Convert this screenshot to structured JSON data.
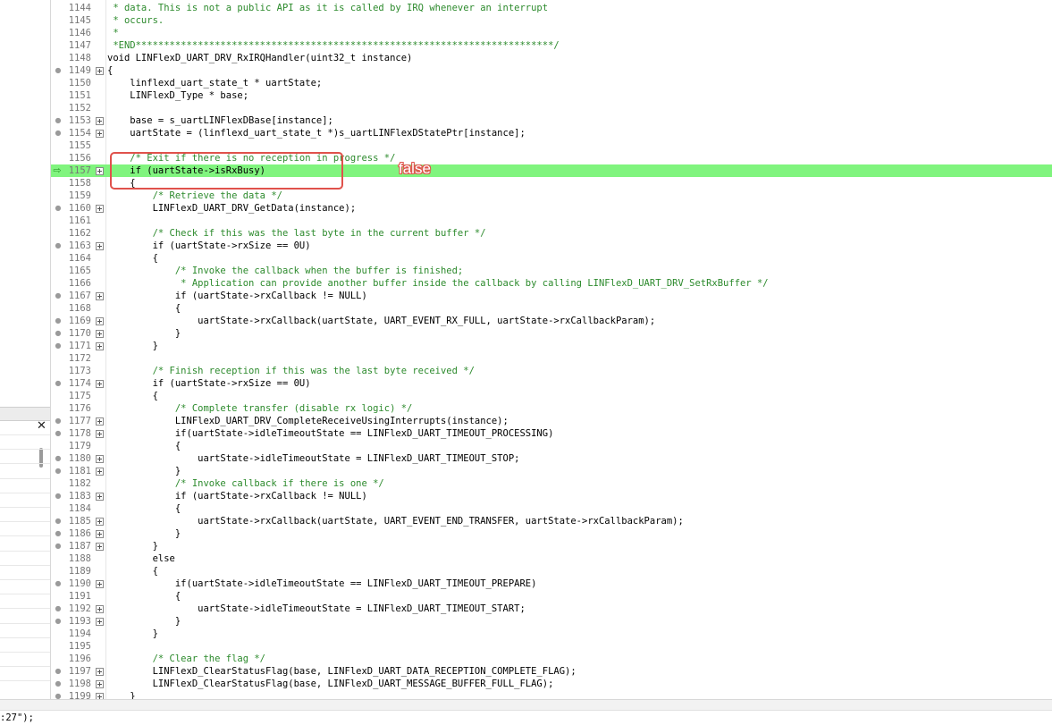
{
  "editor": {
    "lines": [
      {
        "num": "1144",
        "text": " * data. This is not a public API as it is called by IRQ whenever an interrupt",
        "kind": "comment"
      },
      {
        "num": "1145",
        "text": " * occurs.",
        "kind": "comment"
      },
      {
        "num": "1146",
        "text": " *",
        "kind": "comment"
      },
      {
        "num": "1147",
        "text": " *END**************************************************************************/",
        "kind": "comment"
      },
      {
        "num": "1148",
        "text": "void LINFlexD_UART_DRV_RxIRQHandler(uint32_t instance)",
        "kind": "code"
      },
      {
        "num": "1149",
        "text": "{",
        "kind": "code",
        "bp": true,
        "fold": true
      },
      {
        "num": "1150",
        "text": "    linflexd_uart_state_t * uartState;",
        "kind": "code"
      },
      {
        "num": "1151",
        "text": "    LINFlexD_Type * base;",
        "kind": "code"
      },
      {
        "num": "1152",
        "text": "",
        "kind": "code"
      },
      {
        "num": "1153",
        "text": "    base = s_uartLINFlexDBase[instance];",
        "kind": "code",
        "bp": true,
        "fold": true
      },
      {
        "num": "1154",
        "text": "    uartState = (linflexd_uart_state_t *)s_uartLINFlexDStatePtr[instance];",
        "kind": "code",
        "bp": true,
        "fold": true
      },
      {
        "num": "1155",
        "text": "",
        "kind": "code"
      },
      {
        "num": "1156",
        "text": "    /* Exit if there is no reception in progress */",
        "kind": "comment"
      },
      {
        "num": "1157",
        "text": "    if (uartState->isRxBusy)",
        "kind": "code",
        "exec": true,
        "fold": true
      },
      {
        "num": "1158",
        "text": "    {",
        "kind": "code"
      },
      {
        "num": "1159",
        "text": "        /* Retrieve the data */",
        "kind": "comment"
      },
      {
        "num": "1160",
        "text": "        LINFlexD_UART_DRV_GetData(instance);",
        "kind": "code",
        "bp": true,
        "fold": true
      },
      {
        "num": "1161",
        "text": "",
        "kind": "code"
      },
      {
        "num": "1162",
        "text": "        /* Check if this was the last byte in the current buffer */",
        "kind": "comment"
      },
      {
        "num": "1163",
        "text": "        if (uartState->rxSize == 0U)",
        "kind": "code",
        "bp": true,
        "fold": true
      },
      {
        "num": "1164",
        "text": "        {",
        "kind": "code"
      },
      {
        "num": "1165",
        "text": "            /* Invoke the callback when the buffer is finished;",
        "kind": "comment"
      },
      {
        "num": "1166",
        "text": "             * Application can provide another buffer inside the callback by calling LINFlexD_UART_DRV_SetRxBuffer */",
        "kind": "comment"
      },
      {
        "num": "1167",
        "text": "            if (uartState->rxCallback != NULL)",
        "kind": "code",
        "bp": true,
        "fold": true
      },
      {
        "num": "1168",
        "text": "            {",
        "kind": "code"
      },
      {
        "num": "1169",
        "text": "                uartState->rxCallback(uartState, UART_EVENT_RX_FULL, uartState->rxCallbackParam);",
        "kind": "code",
        "bp": true,
        "fold": true
      },
      {
        "num": "1170",
        "text": "            }",
        "kind": "code",
        "bp": true,
        "fold": true
      },
      {
        "num": "1171",
        "text": "        }",
        "kind": "code",
        "bp": true,
        "fold": true
      },
      {
        "num": "1172",
        "text": "",
        "kind": "code"
      },
      {
        "num": "1173",
        "text": "        /* Finish reception if this was the last byte received */",
        "kind": "comment"
      },
      {
        "num": "1174",
        "text": "        if (uartState->rxSize == 0U)",
        "kind": "code",
        "bp": true,
        "fold": true
      },
      {
        "num": "1175",
        "text": "        {",
        "kind": "code"
      },
      {
        "num": "1176",
        "text": "            /* Complete transfer (disable rx logic) */",
        "kind": "comment"
      },
      {
        "num": "1177",
        "text": "            LINFlexD_UART_DRV_CompleteReceiveUsingInterrupts(instance);",
        "kind": "code",
        "bp": true,
        "fold": true
      },
      {
        "num": "1178",
        "text": "            if(uartState->idleTimeoutState == LINFlexD_UART_TIMEOUT_PROCESSING)",
        "kind": "code",
        "bp": true,
        "fold": true
      },
      {
        "num": "1179",
        "text": "            {",
        "kind": "code"
      },
      {
        "num": "1180",
        "text": "                uartState->idleTimeoutState = LINFlexD_UART_TIMEOUT_STOP;",
        "kind": "code",
        "bp": true,
        "fold": true
      },
      {
        "num": "1181",
        "text": "            }",
        "kind": "code",
        "bp": true,
        "fold": true
      },
      {
        "num": "1182",
        "text": "            /* Invoke callback if there is one */",
        "kind": "comment"
      },
      {
        "num": "1183",
        "text": "            if (uartState->rxCallback != NULL)",
        "kind": "code",
        "bp": true,
        "fold": true
      },
      {
        "num": "1184",
        "text": "            {",
        "kind": "code"
      },
      {
        "num": "1185",
        "text": "                uartState->rxCallback(uartState, UART_EVENT_END_TRANSFER, uartState->rxCallbackParam);",
        "kind": "code",
        "bp": true,
        "fold": true
      },
      {
        "num": "1186",
        "text": "            }",
        "kind": "code",
        "bp": true,
        "fold": true
      },
      {
        "num": "1187",
        "text": "        }",
        "kind": "code",
        "bp": true,
        "fold": true
      },
      {
        "num": "1188",
        "text": "        else",
        "kind": "code"
      },
      {
        "num": "1189",
        "text": "        {",
        "kind": "code"
      },
      {
        "num": "1190",
        "text": "            if(uartState->idleTimeoutState == LINFlexD_UART_TIMEOUT_PREPARE)",
        "kind": "code",
        "bp": true,
        "fold": true
      },
      {
        "num": "1191",
        "text": "            {",
        "kind": "code"
      },
      {
        "num": "1192",
        "text": "                uartState->idleTimeoutState = LINFlexD_UART_TIMEOUT_START;",
        "kind": "code",
        "bp": true,
        "fold": true
      },
      {
        "num": "1193",
        "text": "            }",
        "kind": "code",
        "bp": true,
        "fold": true
      },
      {
        "num": "1194",
        "text": "        }",
        "kind": "code"
      },
      {
        "num": "1195",
        "text": "",
        "kind": "code"
      },
      {
        "num": "1196",
        "text": "        /* Clear the flag */",
        "kind": "comment"
      },
      {
        "num": "1197",
        "text": "        LINFlexD_ClearStatusFlag(base, LINFlexD_UART_DATA_RECEPTION_COMPLETE_FLAG);",
        "kind": "code",
        "bp": true,
        "fold": true
      },
      {
        "num": "1198",
        "text": "        LINFlexD_ClearStatusFlag(base, LINFlexD_UART_MESSAGE_BUFFER_FULL_FLAG);",
        "kind": "code",
        "bp": true,
        "fold": true
      },
      {
        "num": "1199",
        "text": "    }",
        "kind": "code",
        "bp": true,
        "fold": true
      }
    ],
    "annotation_text": "false",
    "colors": {
      "exec_line": "#80f47e",
      "comment": "#2c8a2c",
      "annotation": "#e0524c"
    },
    "icons": {
      "current_line": "current-line-arrow-icon",
      "breakpoint": "breakpoint-dot-icon",
      "fold": "fold-expand-icon"
    }
  },
  "left_panel": {
    "close_label": "✕"
  },
  "bottom": {
    "console_text": ":27\");"
  }
}
